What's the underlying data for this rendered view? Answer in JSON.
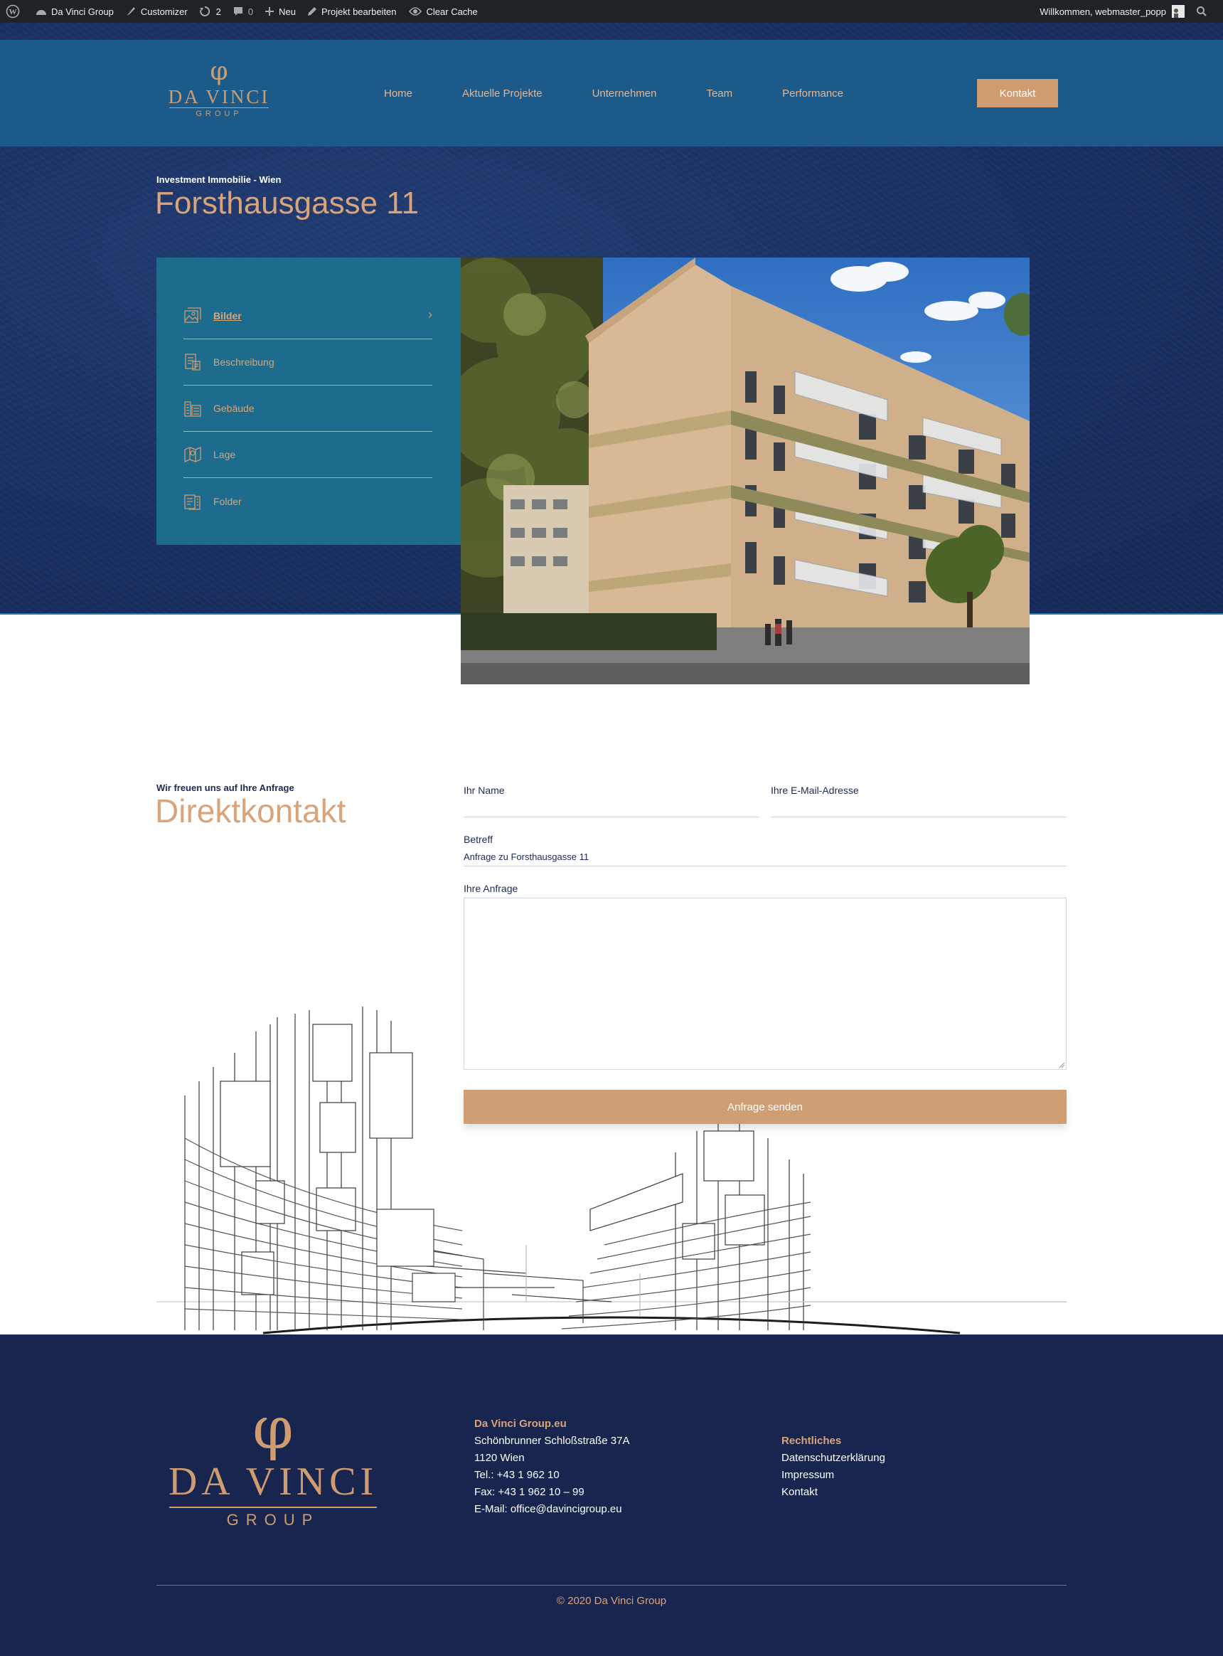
{
  "admin_bar": {
    "site_name": "Da Vinci Group",
    "customizer": "Customizer",
    "updates_count": "2",
    "comments_count": "0",
    "new": "Neu",
    "edit_project": "Projekt bearbeiten",
    "clear_cache": "Clear Cache",
    "greeting": "Willkommen, webmaster_popp"
  },
  "header": {
    "logo": {
      "name": "DA VINCI",
      "group": "GROUP"
    },
    "nav": [
      "Home",
      "Aktuelle Projekte",
      "Unternehmen",
      "Team",
      "Performance"
    ],
    "cta": "Kontakt"
  },
  "project": {
    "eyebrow": "Investment Immobilie - Wien",
    "title": "Forsthausgasse 11"
  },
  "tabs": [
    {
      "label": "Bilder",
      "icon": "images-icon",
      "active": true
    },
    {
      "label": "Beschreibung",
      "icon": "description-icon",
      "active": false
    },
    {
      "label": "Gebäude",
      "icon": "building-icon",
      "active": false
    },
    {
      "label": "Lage",
      "icon": "map-icon",
      "active": false
    },
    {
      "label": "Folder",
      "icon": "folder-icon",
      "active": false
    }
  ],
  "contact": {
    "eyebrow": "Wir freuen uns auf Ihre Anfrage",
    "title": "Direktkontakt",
    "name_label": "Ihr Name",
    "email_label": "Ihre E-Mail-Adresse",
    "subject_label": "Betreff",
    "subject_value": "Anfrage zu Forsthausgasse 11",
    "message_label": "Ihre Anfrage",
    "submit": "Anfrage senden"
  },
  "footer": {
    "logo": {
      "name": "DA VINCI",
      "group": "GROUP"
    },
    "company": {
      "heading": "Da Vinci Group.eu",
      "lines": [
        "Schönbrunner Schloßstraße 37A",
        "1120 Wien",
        "Tel.: +43 1 962 10",
        "Fax: +43 1 962 10 – 99",
        "E-Mail: office@davincigroup.eu"
      ]
    },
    "legal": {
      "heading": "Rechtliches",
      "links": [
        "Datenschutzerklärung",
        "Impressum",
        "Kontakt"
      ]
    },
    "copyright": "© 2020 Da Vinci Group"
  },
  "colors": {
    "accent": "#cf9c70",
    "navy": "#18254f",
    "header_blue": "#1c5a8a",
    "panel_teal": "#1d6c8d"
  }
}
